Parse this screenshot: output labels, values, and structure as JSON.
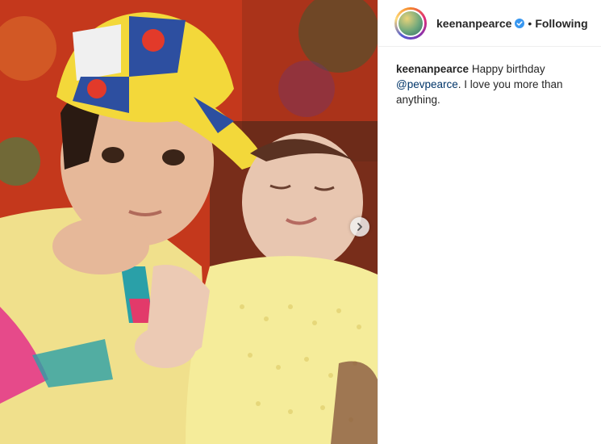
{
  "post": {
    "username": "keenanpearce",
    "separator": "•",
    "follow_status": "Following",
    "caption": {
      "username": "keenanpearce",
      "text_before": "Happy birthday",
      "mention": "@pevpearce",
      "text_after": ". I love you more than anything."
    }
  },
  "icons": {
    "verified": "verified-badge-icon",
    "next": "chevron-right-icon"
  },
  "colors": {
    "verified_blue": "#3897f0",
    "mention_blue": "#003569",
    "text": "#262626",
    "divider": "#efefef"
  }
}
